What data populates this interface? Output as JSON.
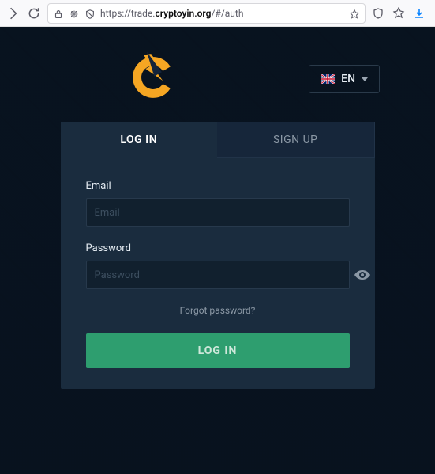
{
  "browser": {
    "url_prefix": "https://trade.",
    "url_host": "cryptoyin.org",
    "url_suffix": "/#/auth"
  },
  "lang": {
    "label": "EN"
  },
  "tabs": {
    "login": "LOG IN",
    "signup": "SIGN UP"
  },
  "form": {
    "email_label": "Email",
    "email_placeholder": "Email",
    "password_label": "Password",
    "password_placeholder": "Password",
    "forgot": "Forgot password?",
    "submit": "LOG IN"
  },
  "colors": {
    "accent": "#2e9e6f",
    "logo": "#f5a623"
  }
}
